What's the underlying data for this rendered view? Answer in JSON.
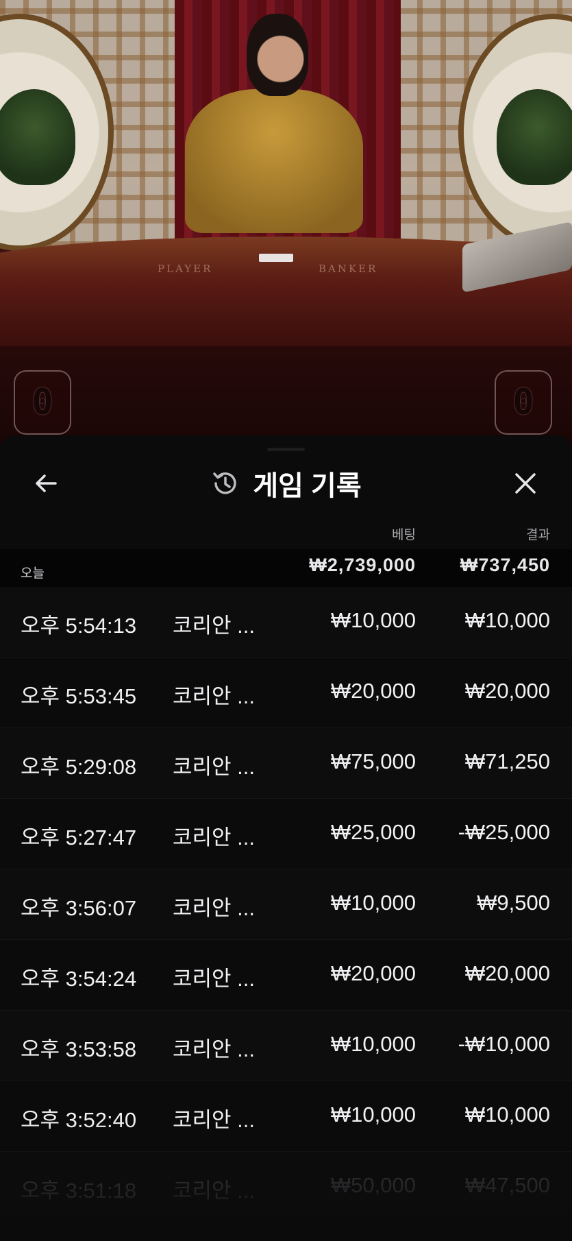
{
  "video": {
    "table_labels": {
      "player": "PLAYER",
      "banker": "BANKER"
    },
    "score_left": "0",
    "score_right": "0"
  },
  "header": {
    "title": "게임 기록",
    "back_icon": "arrow-left-icon",
    "history_icon": "history-clock-icon",
    "close_icon": "close-x-icon"
  },
  "columns": {
    "bet": "베팅",
    "result": "결과"
  },
  "summary": {
    "label": "오늘",
    "bet_total": "₩2,739,000",
    "result_total": "₩737,450"
  },
  "rows": [
    {
      "time": "오후 5:54:13",
      "game": "코리안 ...",
      "bet": "₩10,000",
      "result": "₩10,000"
    },
    {
      "time": "오후 5:53:45",
      "game": "코리안 ...",
      "bet": "₩20,000",
      "result": "₩20,000"
    },
    {
      "time": "오후 5:29:08",
      "game": "코리안 ...",
      "bet": "₩75,000",
      "result": "₩71,250"
    },
    {
      "time": "오후 5:27:47",
      "game": "코리안 ...",
      "bet": "₩25,000",
      "result": "-₩25,000"
    },
    {
      "time": "오후 3:56:07",
      "game": "코리안 ...",
      "bet": "₩10,000",
      "result": "₩9,500"
    },
    {
      "time": "오후 3:54:24",
      "game": "코리안 ...",
      "bet": "₩20,000",
      "result": "₩20,000"
    },
    {
      "time": "오후 3:53:58",
      "game": "코리안 ...",
      "bet": "₩10,000",
      "result": "-₩10,000"
    },
    {
      "time": "오후 3:52:40",
      "game": "코리안 ...",
      "bet": "₩10,000",
      "result": "₩10,000"
    },
    {
      "time": "오후 3:51:18",
      "game": "코리안 ...",
      "bet": "₩50,000",
      "result": "₩47,500"
    }
  ],
  "colors": {
    "panel_bg": "#0b0b0c",
    "text": "#f2f2f4",
    "muted": "#a9a9ad"
  }
}
